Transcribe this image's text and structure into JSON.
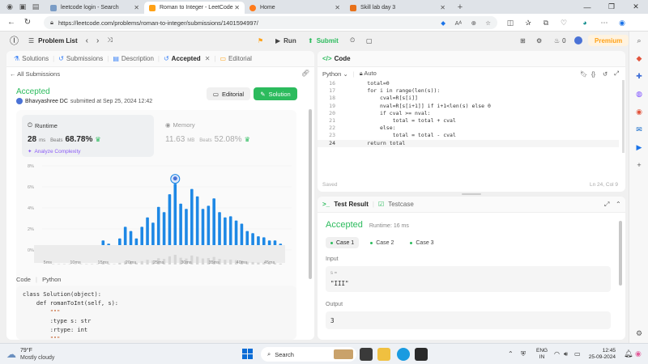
{
  "browser": {
    "tabs": [
      {
        "title": "leetcode login - Search",
        "active": false
      },
      {
        "title": "Roman to Integer - LeetCode",
        "active": true
      },
      {
        "title": "Home",
        "active": false
      },
      {
        "title": "Skill lab day 3",
        "active": false
      }
    ],
    "url": "https://leetcode.com/problems/roman-to-integer/submissions/1401594997/"
  },
  "header": {
    "problem_list": "Problem List",
    "run": "Run",
    "submit": "Submit",
    "streak": "0",
    "premium": "Premium"
  },
  "left_tabs": [
    "Solutions",
    "Submissions",
    "Description",
    "Accepted",
    "Editorial"
  ],
  "submission": {
    "all_submissions": "All Submissions",
    "status": "Accepted",
    "user": "Bhavyashree DC",
    "submitted": "submitted at Sep 25, 2024 12:42",
    "editorial_btn": "Editorial",
    "solution_btn": "Solution",
    "runtime_label": "Runtime",
    "runtime_value": "28",
    "runtime_unit": "ms",
    "beats_label": "Beats",
    "runtime_beats": "68.78%",
    "analyze": "Analyze Complexity",
    "memory_label": "Memory",
    "memory_value": "11.63",
    "memory_unit": "MB",
    "memory_beats": "52.08%"
  },
  "chart_data": {
    "type": "bar",
    "title": "",
    "xlabel": "",
    "ylabel": "",
    "y_ticks": [
      "8%",
      "6%",
      "4%",
      "2%",
      "0%"
    ],
    "ylim": [
      0,
      8
    ],
    "x_ticks": [
      "5ms",
      "10ms",
      "15ms",
      "20ms",
      "25ms",
      "30ms",
      "35ms",
      "40ms",
      "45ms"
    ],
    "xlim": [
      4,
      49
    ],
    "x": [
      6,
      7,
      8,
      9,
      10,
      11,
      12,
      13,
      14,
      15,
      16,
      17,
      18,
      19,
      20,
      21,
      22,
      23,
      24,
      25,
      26,
      27,
      28,
      29,
      30,
      31,
      32,
      33,
      34,
      35,
      36,
      37,
      38,
      39,
      40,
      41,
      42,
      43,
      44,
      45,
      46,
      47
    ],
    "values": [
      0.3,
      0.3,
      0.3,
      0.3,
      0.3,
      0.3,
      0.3,
      0.3,
      0.3,
      0.9,
      0.6,
      0.3,
      1.1,
      2.2,
      1.8,
      1.1,
      2.2,
      3.1,
      2.6,
      4.1,
      3.6,
      5.3,
      6.3,
      4.4,
      3.9,
      5.8,
      5.1,
      3.9,
      4.2,
      4.9,
      3.6,
      3.1,
      3.2,
      2.8,
      2.5,
      1.8,
      1.6,
      1.3,
      1.2,
      0.9,
      0.9,
      0.6
    ],
    "highlight_x": 28
  },
  "code_bottom": {
    "code_tab": "Code",
    "lang": "Python",
    "lines": [
      "class Solution(object):",
      "    def romanToInt(self, s):",
      "        \"\"\"",
      "        :type s: str",
      "        :rtype: int",
      "        \"\"\""
    ]
  },
  "editor": {
    "title": "Code",
    "lang": "Python",
    "auto": "Auto",
    "saved": "Saved",
    "cursor": "Ln 24, Col 9",
    "lines": [
      {
        "n": "16",
        "t": "        total=0"
      },
      {
        "n": "17",
        "t": "        for i in range(len(s)):"
      },
      {
        "n": "18",
        "t": "            cval=R[s[i]]"
      },
      {
        "n": "19",
        "t": "            nval=R[s[i+1]] if i+1<len(s) else 0"
      },
      {
        "n": "20",
        "t": "            if cval >= nval:"
      },
      {
        "n": "21",
        "t": "                total = total + cval"
      },
      {
        "n": "22",
        "t": "            else:"
      },
      {
        "n": "23",
        "t": "                total = total - cval"
      },
      {
        "n": "24",
        "t": "        return total"
      }
    ]
  },
  "test": {
    "result_tab": "Test Result",
    "testcase_tab": "Testcase",
    "status": "Accepted",
    "runtime": "Runtime: 16 ms",
    "cases": [
      "Case 1",
      "Case 2",
      "Case 3"
    ],
    "input_label": "Input",
    "var": "s =",
    "input_value": "\"III\"",
    "output_label": "Output",
    "output_value": "3"
  },
  "taskbar": {
    "temp": "79°F",
    "weather": "Mostly cloudy",
    "search": "Search",
    "lang1": "ENG",
    "lang2": "IN",
    "time": "12:45",
    "date": "25-09-2024"
  },
  "colors": {
    "green": "#2cbb5d",
    "accent": "#1e88e5",
    "premium": "#ffa116",
    "editor_blue": "#0000ff"
  }
}
